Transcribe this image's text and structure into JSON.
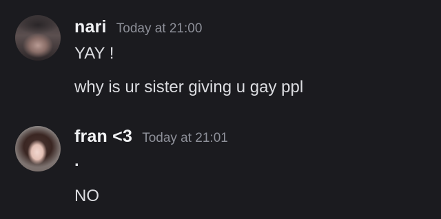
{
  "messages": [
    {
      "username": "nari",
      "timestamp": "Today at 21:00",
      "lines": [
        "YAY !",
        "why is ur sister giving u gay ppl"
      ]
    },
    {
      "username": "fran <3",
      "timestamp": "Today at 21:01",
      "lines": [
        ".",
        "NO"
      ]
    }
  ],
  "colors": {
    "background": "#1b1b1f",
    "username": "#f2f3f5",
    "timestamp": "#8e9099",
    "message_text": "#dcdde1"
  }
}
